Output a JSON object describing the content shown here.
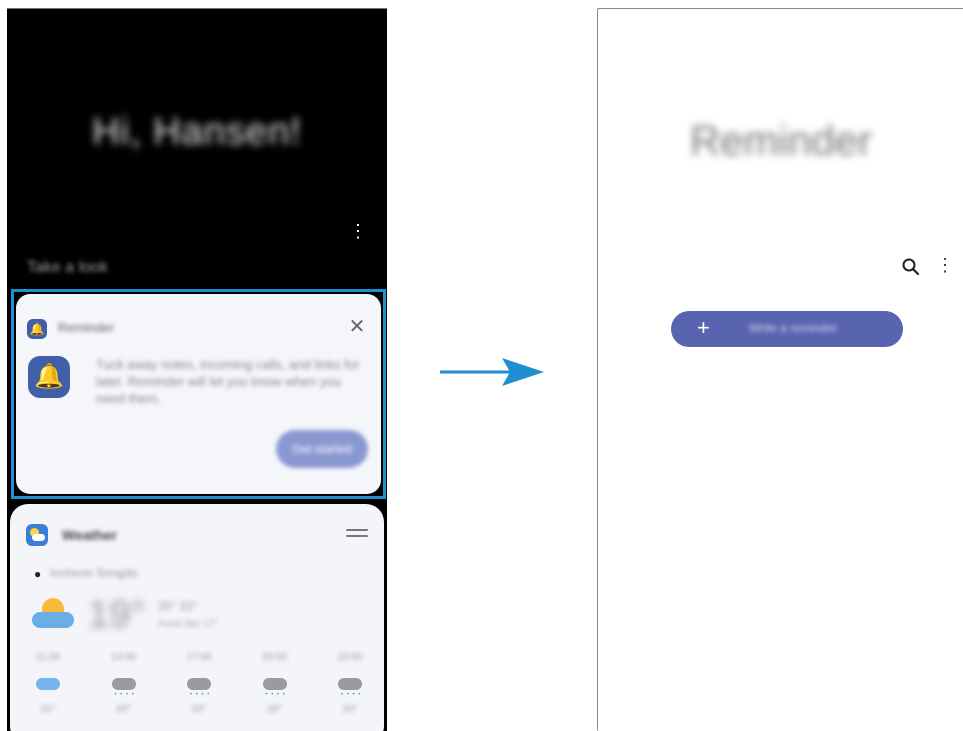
{
  "left_screen": {
    "greeting": "Hi, Hansen!",
    "more_icon": "more-vertical-icon",
    "section_label": "Take a look",
    "reminder_card": {
      "app_name": "Reminder",
      "close_icon": "close-icon",
      "description": "Tuck away notes, incoming calls, and links for later. Reminder will let you know when you need them.",
      "button_label": "Get started",
      "highlight_color": "#1f8fd0"
    },
    "weather_card": {
      "app_name": "Weather",
      "location": "Incheon Songdo",
      "current_temp": "19°",
      "temp_range": "20° 22°",
      "feels_like": "Feels like 17°",
      "hourly": [
        {
          "time": "11:00",
          "icon": "cloud-icon",
          "temp": "21°"
        },
        {
          "time": "14:00",
          "icon": "rain-icon",
          "temp": "20°"
        },
        {
          "time": "17:00",
          "icon": "rain-icon",
          "temp": "20°"
        },
        {
          "time": "20:00",
          "icon": "rain-icon",
          "temp": "20°"
        },
        {
          "time": "23:00",
          "icon": "rain-icon",
          "temp": "20°"
        }
      ]
    }
  },
  "right_screen": {
    "title": "Reminder",
    "search_icon": "search-icon",
    "more_icon": "more-vertical-icon",
    "write_button": {
      "icon": "plus-icon",
      "label": "Write a reminder",
      "color": "#5864b0"
    }
  },
  "transition_arrow": {
    "color": "#1f8fd0"
  }
}
